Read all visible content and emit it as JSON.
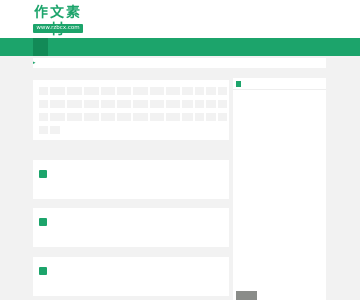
{
  "header": {
    "logo_title": "作文素材",
    "logo_url": "www.rzbcx.com"
  },
  "nav": {
    "items": [
      {
        "label": ""
      },
      {
        "label": ""
      },
      {
        "label": ""
      },
      {
        "label": ""
      },
      {
        "label": ""
      },
      {
        "label": ""
      },
      {
        "label": ""
      }
    ]
  },
  "notice": {
    "text": ""
  },
  "tags": [
    "",
    "",
    "",
    "",
    "",
    "",
    "",
    "",
    "",
    "",
    "",
    "",
    "",
    "",
    "",
    "",
    "",
    "",
    "",
    "",
    "",
    "",
    "",
    "",
    "",
    "",
    "",
    "",
    "",
    "",
    "",
    "",
    "",
    "",
    "",
    "",
    "",
    "",
    "",
    "",
    "",
    "",
    "",
    "",
    "",
    "",
    "",
    "",
    "",
    "",
    "",
    "",
    "",
    "",
    "",
    "",
    "",
    "",
    "",
    "",
    "",
    "",
    "",
    "",
    "",
    "",
    "",
    "",
    "",
    "",
    "",
    "",
    ""
  ],
  "cards": [
    {
      "title": "",
      "desc": ""
    },
    {
      "title": "",
      "desc": ""
    },
    {
      "title": "",
      "desc": ""
    }
  ],
  "sidebar": {
    "title": "",
    "items": [
      "",
      "",
      "",
      "",
      "",
      "",
      "",
      "",
      "",
      "",
      ""
    ],
    "thumb_text": ""
  },
  "colors": {
    "brand_green": "#1ca46b",
    "nav_active": "#128a57",
    "page_bg": "#f2f2f2"
  }
}
